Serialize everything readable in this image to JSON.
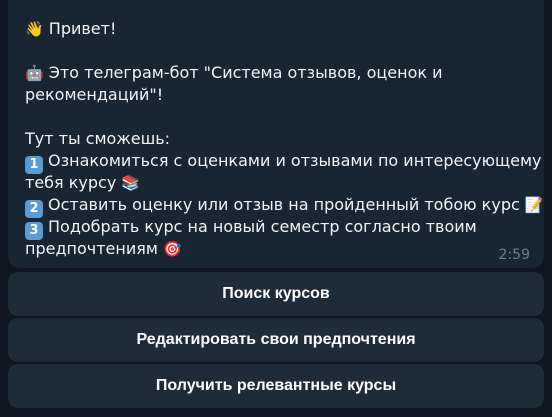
{
  "message": {
    "greeting": "Привет!",
    "intro_line1": "Это телеграм-бот \"Система отзывов, оценок и",
    "intro_line2": "рекомендаций\"!",
    "list_title": "Тут ты сможешь:",
    "item1_num": "1",
    "item1_line1": "Ознакомиться с оценками и отзывами по интересующему",
    "item1_line2": "тебя курсу",
    "item2_num": "2",
    "item2_line1": "Оставить оценку или отзыв на пройденный тобою курс",
    "item3_num": "3",
    "item3_line1": "Подобрать курс на новый семестр согласно твоим",
    "item3_line2": "предпочтениям",
    "time": "2:59",
    "emoji": {
      "greeting": "👋",
      "robot": "🤖",
      "books": "📚",
      "memo": "📝",
      "target": "🎯"
    }
  },
  "keyboard": {
    "buttons": [
      {
        "label": "Поиск курсов"
      },
      {
        "label": "Редактировать свои предпочтения"
      },
      {
        "label": "Получить релевантные курсы"
      }
    ]
  },
  "colors": {
    "background": "#0e1621",
    "bubble": "#182533",
    "button": "#1e2c3a",
    "text": "#f2f5f8",
    "time": "#6d7f8f",
    "keycap": "#5b9bd5"
  }
}
